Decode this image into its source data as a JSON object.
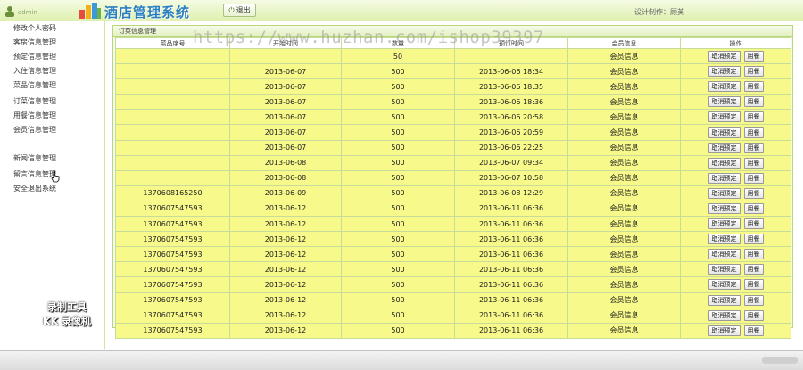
{
  "header": {
    "app_title": "酒店管理系统",
    "logout_label": "退出",
    "designer": "设计制作：顾英",
    "user_hint": "admin"
  },
  "sidebar": {
    "items": [
      {
        "label": "修改个人密码"
      },
      {
        "label": "客房信息管理"
      },
      {
        "label": "预定信息管理"
      },
      {
        "label": "入住信息管理"
      },
      {
        "label": "菜品信息管理"
      },
      {
        "label": "订菜信息管理"
      },
      {
        "label": "用餐信息管理"
      },
      {
        "label": "会员信息管理"
      },
      {
        "label": "新闻信息管理"
      },
      {
        "label": "留言信息管理"
      },
      {
        "label": "安全退出系统"
      }
    ]
  },
  "watermark": {
    "line1": "录制工具",
    "line2": "KK 录像机",
    "url": "https://www.huzhan.com/ishop39397"
  },
  "panel": {
    "title": "订菜信息管理",
    "columns": [
      "菜品序号",
      "开始时间",
      "数量",
      "预订时间",
      "会员信息",
      "操作"
    ],
    "cancel_label": "取消预定",
    "dine_label": "用餐",
    "rows": [
      {
        "dish": "",
        "start": "",
        "qty": "50",
        "booked": "",
        "member": "会员信息"
      },
      {
        "dish": "",
        "start": "2013-06-07",
        "qty": "500",
        "booked": "2013-06-06 18:34",
        "member": "会员信息"
      },
      {
        "dish": "",
        "start": "2013-06-07",
        "qty": "500",
        "booked": "2013-06-06 18:35",
        "member": "会员信息"
      },
      {
        "dish": "",
        "start": "2013-06-07",
        "qty": "500",
        "booked": "2013-06-06 18:36",
        "member": "会员信息"
      },
      {
        "dish": "",
        "start": "2013-06-07",
        "qty": "500",
        "booked": "2013-06-06 20:58",
        "member": "会员信息"
      },
      {
        "dish": "",
        "start": "2013-06-07",
        "qty": "500",
        "booked": "2013-06-06 20:59",
        "member": "会员信息"
      },
      {
        "dish": "",
        "start": "2013-06-07",
        "qty": "500",
        "booked": "2013-06-06 22:25",
        "member": "会员信息"
      },
      {
        "dish": "",
        "start": "2013-06-08",
        "qty": "500",
        "booked": "2013-06-07 09:34",
        "member": "会员信息"
      },
      {
        "dish": "",
        "start": "2013-06-08",
        "qty": "500",
        "booked": "2013-06-07 10:58",
        "member": "会员信息"
      },
      {
        "dish": "1370608165250",
        "start": "2013-06-09",
        "qty": "500",
        "booked": "2013-06-08 12:29",
        "member": "会员信息"
      },
      {
        "dish": "1370607547593",
        "start": "2013-06-12",
        "qty": "500",
        "booked": "2013-06-11 06:36",
        "member": "会员信息"
      },
      {
        "dish": "1370607547593",
        "start": "2013-06-12",
        "qty": "500",
        "booked": "2013-06-11 06:36",
        "member": "会员信息"
      },
      {
        "dish": "1370607547593",
        "start": "2013-06-12",
        "qty": "500",
        "booked": "2013-06-11 06:36",
        "member": "会员信息"
      },
      {
        "dish": "1370607547593",
        "start": "2013-06-12",
        "qty": "500",
        "booked": "2013-06-11 06:36",
        "member": "会员信息"
      },
      {
        "dish": "1370607547593",
        "start": "2013-06-12",
        "qty": "500",
        "booked": "2013-06-11 06:36",
        "member": "会员信息"
      },
      {
        "dish": "1370607547593",
        "start": "2013-06-12",
        "qty": "500",
        "booked": "2013-06-11 06:36",
        "member": "会员信息"
      },
      {
        "dish": "1370607547593",
        "start": "2013-06-12",
        "qty": "500",
        "booked": "2013-06-11 06:36",
        "member": "会员信息"
      },
      {
        "dish": "1370607547593",
        "start": "2013-06-12",
        "qty": "500",
        "booked": "2013-06-11 06:36",
        "member": "会员信息"
      },
      {
        "dish": "1370607547593",
        "start": "2013-06-12",
        "qty": "500",
        "booked": "2013-06-11 06:36",
        "member": "会员信息"
      }
    ]
  },
  "colors": {
    "accent": "#2a7fbf",
    "row_fill": "#f7f98a",
    "border": "#c8dc9a"
  },
  "icons": {
    "logout": "power-icon",
    "cursor": "hand-cursor-icon"
  }
}
